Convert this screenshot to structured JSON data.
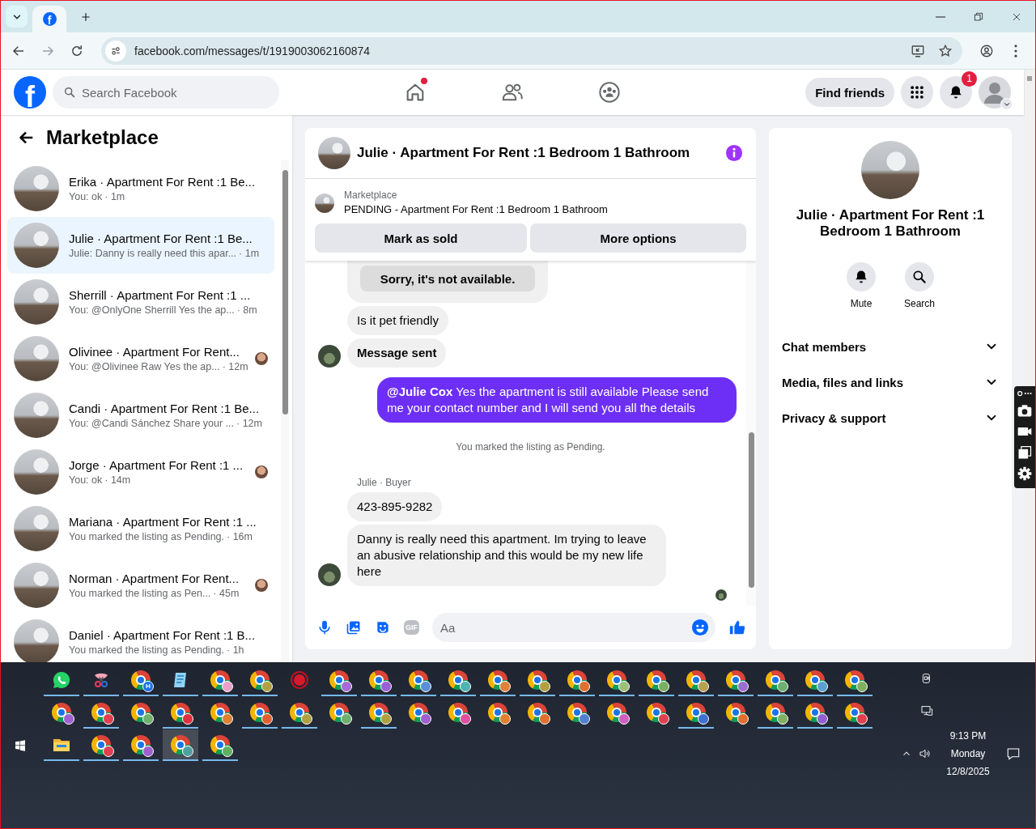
{
  "browser": {
    "tabs": [
      {
        "favicon_text": "f",
        "selected": true
      }
    ],
    "url": "facebook.com/messages/t/1919003062160874"
  },
  "header": {
    "logo": "f",
    "search_placeholder": "Search Facebook",
    "nav": [
      {
        "kind": "home",
        "notify": true
      },
      {
        "kind": "friends",
        "notify": false
      },
      {
        "kind": "groups",
        "notify": false
      }
    ],
    "find_friends": "Find friends",
    "notification_count": "1"
  },
  "sidebar": {
    "title": "Marketplace",
    "conversations": [
      {
        "title": "Erika · Apartment For Rent :1 Be...",
        "preview": "You: ok",
        "time": "· 1m",
        "selected": false,
        "seen": false
      },
      {
        "title": "Julie · Apartment For Rent :1 Be...",
        "preview": "Julie: Danny is really need this apar...",
        "time": "· 1m",
        "selected": true,
        "seen": false
      },
      {
        "title": "Sherrill · Apartment For Rent :1 ...",
        "preview": "You: @OnlyOne Sherrill Yes the ap...",
        "time": "· 8m",
        "selected": false,
        "seen": false
      },
      {
        "title": "Olivinee · Apartment For Rent...",
        "preview": "You: @Olivinee Raw Yes the ap...",
        "time": "· 12m",
        "selected": false,
        "seen": true
      },
      {
        "title": "Candi · Apartment For Rent :1 Be...",
        "preview": "You: @Candi Sánchez Share your ...",
        "time": "· 12m",
        "selected": false,
        "seen": false
      },
      {
        "title": "Jorge · Apartment For Rent :1 ...",
        "preview": "You: ok",
        "time": "· 14m",
        "selected": false,
        "seen": true
      },
      {
        "title": "Mariana · Apartment For Rent :1 ...",
        "preview": "You marked the listing as Pending.",
        "time": "· 16m",
        "selected": false,
        "seen": false
      },
      {
        "title": "Norman · Apartment For Rent...",
        "preview": "You marked the listing as Pen...",
        "time": "· 45m",
        "selected": false,
        "seen": true
      },
      {
        "title": "Daniel · Apartment For Rent :1 B...",
        "preview": "You marked the listing as Pending.",
        "time": "· 1h",
        "selected": false,
        "seen": false
      }
    ]
  },
  "chat": {
    "title": "Julie · Apartment For Rent :1 Bedroom 1 Bathroom",
    "listing": {
      "label": "Marketplace",
      "status": "PENDING - Apartment For Rent :1 Bedroom 1 Bathroom",
      "buttons": [
        "Mark as sold",
        "More options"
      ]
    },
    "messages": [
      {
        "kind": "options",
        "options": [
          "Sorry, it's not available."
        ]
      },
      {
        "kind": "incoming",
        "text": "Is it pet friendly",
        "avatar": false,
        "emphasis": false
      },
      {
        "kind": "incoming",
        "text": "Message sent",
        "avatar": true,
        "emphasis": true
      },
      {
        "kind": "outgoing",
        "text": "**@Julie Cox** Yes the apartment is still available Please send me your contact number and I will send you all the details"
      },
      {
        "kind": "system",
        "text": "You marked the listing as Pending."
      },
      {
        "kind": "sender",
        "text": "Julie · Buyer"
      },
      {
        "kind": "incoming",
        "text": "423-895-9282",
        "avatar": false,
        "emphasis": false
      },
      {
        "kind": "incoming",
        "text": "Danny is really need this apartment.  Im trying to leave an abusive relationship and this would be my new life here",
        "avatar": true,
        "emphasis": false
      },
      {
        "kind": "seen"
      }
    ],
    "composer": {
      "gif_label": "GIF",
      "placeholder": "Aa"
    }
  },
  "details": {
    "title": "Julie · Apartment For Rent :1 Bedroom 1 Bathroom",
    "actions": [
      {
        "kind": "mute",
        "label": "Mute"
      },
      {
        "kind": "search",
        "label": "Search"
      }
    ],
    "sections": [
      {
        "label": "Chat members",
        "expanded": false
      },
      {
        "label": "Media, files and links",
        "expanded": false
      },
      {
        "label": "Privacy & support",
        "expanded": false
      }
    ]
  },
  "taskbar": {
    "rows": [
      [
        {
          "kind": "whatsapp",
          "running": true,
          "selected": false
        },
        {
          "kind": "snipping",
          "running": true,
          "selected": false
        },
        {
          "kind": "chrome",
          "color": "#1a73e8",
          "badge_text": "H",
          "running": true,
          "selected": false
        },
        {
          "kind": "notepad",
          "running": true,
          "selected": false
        },
        {
          "kind": "chrome",
          "color": "#f0a0c8",
          "running": true,
          "selected": false
        },
        {
          "kind": "chrome",
          "color": "#b0a040",
          "running": true,
          "selected": false
        },
        {
          "kind": "recorder",
          "running": false,
          "selected": false
        },
        {
          "kind": "chrome",
          "color": "#a56bd6",
          "running": true,
          "selected": false
        },
        {
          "kind": "chrome",
          "color": "#9b5fd6",
          "running": true,
          "selected": false
        },
        {
          "kind": "chrome",
          "color": "#5b8fd8",
          "running": true,
          "selected": false
        },
        {
          "kind": "chrome",
          "color": "#4fb3b3",
          "running": true,
          "selected": false
        },
        {
          "kind": "chrome",
          "color": "#e0803a",
          "running": true,
          "selected": false
        },
        {
          "kind": "chrome",
          "color": "#b0a040",
          "running": true,
          "selected": false
        },
        {
          "kind": "chrome",
          "color": "#e07030",
          "running": true,
          "selected": false
        },
        {
          "kind": "chrome",
          "color": "#9cc07a",
          "running": true,
          "selected": false
        },
        {
          "kind": "chrome",
          "color": "#7ab060",
          "running": true,
          "selected": false
        },
        {
          "kind": "chrome",
          "color": "#b8a050",
          "running": true,
          "selected": false
        },
        {
          "kind": "chrome",
          "color": "#9b6fd0",
          "running": true,
          "selected": false
        },
        {
          "kind": "chrome",
          "color": "#6db070",
          "running": true,
          "selected": false
        },
        {
          "kind": "chrome",
          "color": "#5aa0d0",
          "running": true,
          "selected": false
        },
        {
          "kind": "chrome",
          "color": "#80b060",
          "running": true,
          "selected": false
        }
      ],
      [
        {
          "kind": "chrome",
          "color": "#a060d0",
          "running": false,
          "selected": false
        },
        {
          "kind": "chrome",
          "color": "#e04050",
          "running": true,
          "selected": false
        },
        {
          "kind": "chrome",
          "color": "#70b070",
          "running": false,
          "selected": false
        },
        {
          "kind": "chrome",
          "color": "#e03040",
          "running": true,
          "selected": false
        },
        {
          "kind": "chrome",
          "color": "#e08030",
          "running": false,
          "selected": false
        },
        {
          "kind": "chrome",
          "color": "#e06030",
          "running": true,
          "selected": false
        },
        {
          "kind": "chrome",
          "color": "#b0a040",
          "running": true,
          "selected": false
        },
        {
          "kind": "chrome",
          "color": "#70b070",
          "running": false,
          "selected": false
        },
        {
          "kind": "chrome",
          "color": "#b0a040",
          "running": true,
          "selected": false
        },
        {
          "kind": "chrome",
          "color": "#a060d0",
          "running": false,
          "selected": false
        },
        {
          "kind": "chrome",
          "color": "#e050a0",
          "running": false,
          "selected": false
        },
        {
          "kind": "chrome",
          "color": "#e08030",
          "running": false,
          "selected": false
        },
        {
          "kind": "chrome",
          "color": "#e07030",
          "running": false,
          "selected": false
        },
        {
          "kind": "chrome",
          "color": "#5080d0",
          "running": false,
          "selected": false
        },
        {
          "kind": "chrome",
          "color": "#d060c0",
          "running": false,
          "selected": false
        },
        {
          "kind": "chrome",
          "color": "#e04050",
          "running": false,
          "selected": false
        },
        {
          "kind": "chrome",
          "color": "#4070d0",
          "running": true,
          "selected": false
        },
        {
          "kind": "chrome",
          "color": "#e07030",
          "running": false,
          "selected": false
        },
        {
          "kind": "chrome",
          "color": "#80b060",
          "running": true,
          "selected": false
        },
        {
          "kind": "chrome",
          "color": "#9060d0",
          "running": true,
          "selected": false
        },
        {
          "kind": "chrome",
          "color": "#e04050",
          "running": true,
          "selected": false
        }
      ],
      [
        {
          "kind": "explorer",
          "running": true,
          "selected": false
        },
        {
          "kind": "chrome",
          "color": "#e04050",
          "running": true,
          "selected": false
        },
        {
          "kind": "chrome",
          "color": "#a060d0",
          "running": true,
          "selected": false
        },
        {
          "kind": "chrome",
          "color": "#50a0a0",
          "running": true,
          "selected": true
        },
        {
          "kind": "chrome",
          "color": "#60b060",
          "running": true,
          "selected": false
        }
      ]
    ],
    "clock": {
      "time": "9:13 PM",
      "day": "Monday",
      "date": "12/8/2025"
    }
  }
}
